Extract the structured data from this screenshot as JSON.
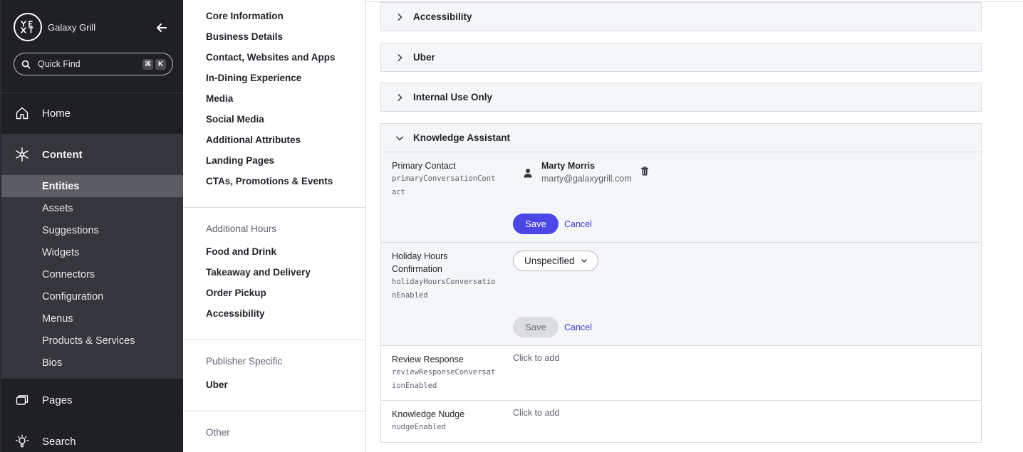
{
  "sidebar": {
    "logo_text": "YEXT",
    "brand_name": "Galaxy Grill",
    "quick_find": {
      "label": "Quick Find",
      "shortcut": [
        "⌘",
        "K"
      ]
    },
    "nav": {
      "home": "Home",
      "content": "Content",
      "pages": "Pages",
      "search": "Search"
    },
    "content_items": [
      "Entities",
      "Assets",
      "Suggestions",
      "Widgets",
      "Connectors",
      "Configuration",
      "Menus",
      "Products & Services",
      "Bios"
    ],
    "active_item": "Entities"
  },
  "midnav": {
    "links": [
      "Core Information",
      "Business Details",
      "Contact, Websites and Apps",
      "In-Dining Experience",
      "Media",
      "Social Media",
      "Additional Attributes",
      "Landing Pages",
      "CTAs, Promotions & Events"
    ],
    "additional_hours": {
      "heading": "Additional Hours",
      "links": [
        "Food and Drink",
        "Takeaway and Delivery",
        "Order Pickup",
        "Accessibility"
      ]
    },
    "publisher_specific": {
      "heading": "Publisher Specific",
      "links": [
        "Uber"
      ]
    },
    "other": {
      "heading": "Other"
    }
  },
  "main": {
    "collapsed_sections": [
      "Accessibility",
      "Uber",
      "Internal Use Only"
    ],
    "knowledge_assistant": {
      "title": "Knowledge Assistant",
      "primary_contact": {
        "label": "Primary Contact",
        "key": "primaryConversationContact",
        "name": "Marty Morris",
        "email": "marty@galaxygrill.com",
        "save": "Save",
        "cancel": "Cancel"
      },
      "holiday_hours": {
        "label": "Holiday Hours Confirmation",
        "key": "holidayHoursConversationEnabled",
        "value": "Unspecified",
        "save": "Save",
        "cancel": "Cancel"
      },
      "review_response": {
        "label": "Review Response",
        "key": "reviewResponseConversationEnabled",
        "value": "Click to add"
      },
      "knowledge_nudge": {
        "label": "Knowledge Nudge",
        "key": "nudgeEnabled",
        "value": "Click to add"
      }
    }
  },
  "colors": {
    "accent": "#4b46e5",
    "sidebar_bg": "#1f2024",
    "sidebar_active": "#35363b"
  }
}
